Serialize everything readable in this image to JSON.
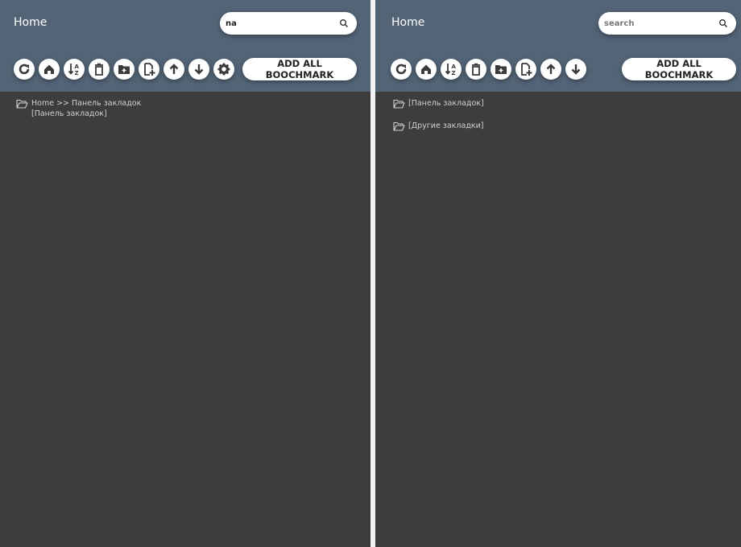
{
  "left_panel": {
    "title": "Home",
    "search": {
      "value": "na",
      "placeholder": "search"
    },
    "toolbar": [
      {
        "icon": "refresh-icon",
        "name": "refresh-button"
      },
      {
        "icon": "home-icon",
        "name": "home-button"
      },
      {
        "icon": "sort-az-icon",
        "name": "sort-button"
      },
      {
        "icon": "trash-icon",
        "name": "delete-button"
      },
      {
        "icon": "folder-plus-icon",
        "name": "add-folder-button"
      },
      {
        "icon": "file-plus-icon",
        "name": "add-bookmark-button"
      },
      {
        "icon": "arrow-up-icon",
        "name": "move-up-button"
      },
      {
        "icon": "arrow-down-icon",
        "name": "move-down-button"
      },
      {
        "icon": "gear-icon",
        "name": "settings-button"
      }
    ],
    "add_all_label": "ADD ALL BOOCHMARK",
    "results": [
      {
        "path": "Home >> Панель закладок",
        "name": "[Панель закладок]"
      }
    ]
  },
  "right_panel": {
    "title": "Home",
    "search": {
      "value": "",
      "placeholder": "search"
    },
    "toolbar": [
      {
        "icon": "refresh-icon",
        "name": "refresh-button"
      },
      {
        "icon": "home-icon",
        "name": "home-button"
      },
      {
        "icon": "sort-az-icon",
        "name": "sort-button"
      },
      {
        "icon": "trash-icon",
        "name": "delete-button"
      },
      {
        "icon": "folder-plus-icon",
        "name": "add-folder-button"
      },
      {
        "icon": "file-plus-icon",
        "name": "add-bookmark-button"
      },
      {
        "icon": "arrow-up-icon",
        "name": "move-up-button"
      },
      {
        "icon": "arrow-down-icon",
        "name": "move-down-button"
      }
    ],
    "add_all_label": "ADD ALL BOOCHMARK",
    "folders": [
      "[Панель закладок]",
      "[Другие закладки]"
    ]
  },
  "colors": {
    "header": "#526476",
    "background": "#3d3d3d",
    "text": "#cfcfcf"
  }
}
